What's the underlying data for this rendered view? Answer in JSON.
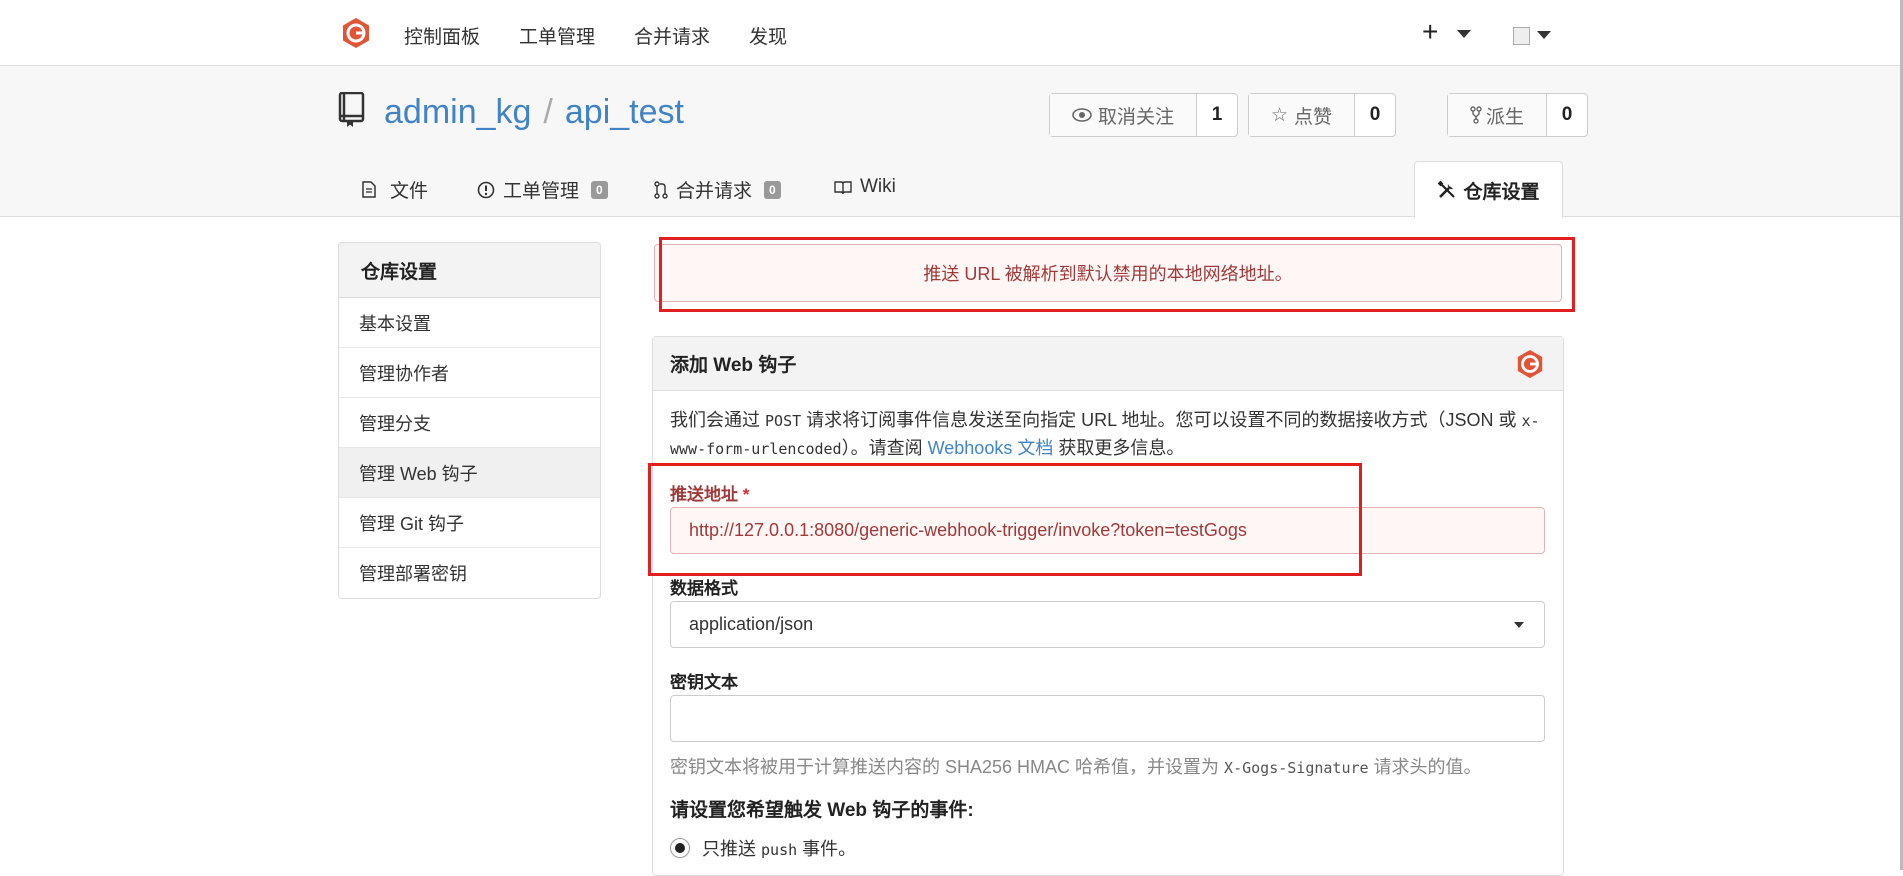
{
  "topnav": {
    "items": [
      "控制面板",
      "工单管理",
      "合并请求",
      "发现"
    ],
    "plus": "+"
  },
  "repo": {
    "owner": "admin_kg",
    "separator": "/",
    "name": "api_test",
    "watch": {
      "label": "取消关注",
      "count": "1"
    },
    "star": {
      "label": "点赞",
      "count": "0"
    },
    "fork": {
      "label": "派生",
      "count": "0"
    }
  },
  "tabs": {
    "files": "文件",
    "issues": {
      "label": "工单管理",
      "badge": "0"
    },
    "pulls": {
      "label": "合并请求",
      "badge": "0"
    },
    "wiki": "Wiki",
    "settings": "仓库设置"
  },
  "sidebar": {
    "header": "仓库设置",
    "items": [
      "基本设置",
      "管理协作者",
      "管理分支",
      "管理 Web 钩子",
      "管理 Git 钩子",
      "管理部署密钥"
    ],
    "active_index": 3
  },
  "error": {
    "message": "推送 URL 被解析到默认禁用的本地网络地址。"
  },
  "form": {
    "title": "添加 Web 钩子",
    "desc_1": "我们会通过 ",
    "desc_post": "POST",
    "desc_2": " 请求将订阅事件信息发送至向指定 URL 地址。您可以设置不同的数据接收方式（JSON 或 ",
    "desc_xform": "x-www-form-urlencoded",
    "desc_3": "）。请查阅 ",
    "desc_link": "Webhooks 文档",
    "desc_4": " 获取更多信息。",
    "url_label": "推送地址",
    "required_mark": "*",
    "url_value": "http://127.0.0.1:8080/generic-webhook-trigger/invoke?token=testGogs",
    "format_label": "数据格式",
    "format_value": "application/json",
    "secret_label": "密钥文本",
    "secret_value": "",
    "help_1": "密钥文本将被用于计算推送内容的 SHA256 HMAC 哈希值，并设置为 ",
    "help_header": "X-Gogs-Signature",
    "help_2": " 请求头的值。",
    "events_title": "请设置您希望触发 Web 钩子的事件:",
    "radio_push": "只推送 ",
    "radio_push_code": "push",
    "radio_push_2": " 事件。"
  },
  "colors": {
    "accent": "#4183c4",
    "error_text": "#9f3a38",
    "error_bg": "#fff6f6",
    "highlight": "#e21f1f",
    "logo": "#e15436"
  }
}
